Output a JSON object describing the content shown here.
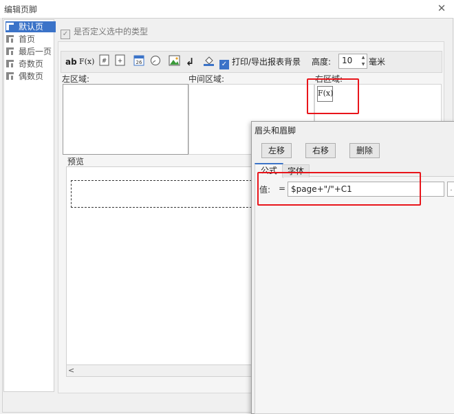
{
  "window": {
    "title": "编辑页脚",
    "close_glyph": "✕"
  },
  "pages": [
    {
      "label": "默认页",
      "selected": true
    },
    {
      "label": "首页",
      "selected": false
    },
    {
      "label": "最后一页",
      "selected": false
    },
    {
      "label": "奇数页",
      "selected": false
    },
    {
      "label": "偶数页",
      "selected": false
    }
  ],
  "custom_type": {
    "label": "是否定义选中的类型",
    "checked": true
  },
  "toolbar": {
    "text_btn": "ab",
    "formula_btn": "F(x)",
    "print_export": {
      "label": "打印/导出报表背景",
      "checked": true
    },
    "height_label": "高度:",
    "height_value": "10",
    "height_unit": "毫米",
    "icons": [
      "page-number-icon",
      "total-pages-icon",
      "date-icon",
      "time-icon",
      "image-icon",
      "newline-icon",
      "background-fill-icon"
    ]
  },
  "regions": {
    "left": "左区域:",
    "middle": "中间区域:",
    "right": "右区域:",
    "right_item": "F(x)",
    "preview": "预览"
  },
  "subdialog": {
    "title": "眉头和眉脚",
    "move_left": "左移",
    "move_right": "右移",
    "delete": "删除",
    "tabs": [
      "公式",
      "字体"
    ],
    "value_label": "值:",
    "equals": "=",
    "value": "$page+\"/\"+C1"
  },
  "colors": {
    "accent": "#3b73c8",
    "highlight": "#e8141a"
  }
}
